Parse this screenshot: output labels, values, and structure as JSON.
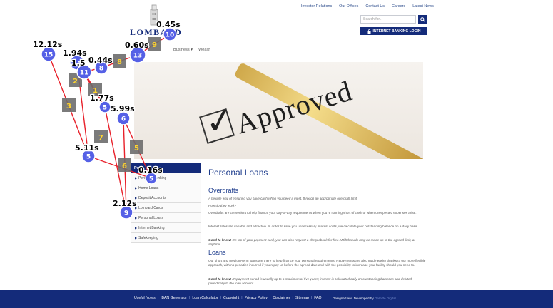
{
  "header": {
    "top_links": [
      "Investor Relations",
      "Our Offices",
      "Contact Us",
      "Careers",
      "Latest News"
    ],
    "search_placeholder": "Search for...",
    "search_icon": "search-icon",
    "login_icon": "lock-icon",
    "login_label": "INTERNET BANKING LOGIN",
    "logo_text": "LOMBARD",
    "nav": [
      "Business ▾",
      "Wealth"
    ]
  },
  "hero": {
    "word": "Approved"
  },
  "sidebar": {
    "title": "Pe",
    "items": [
      "Personal Banking",
      "Home Loans",
      "Deposit Accounts",
      "Lombard Cards",
      "Personal Loans",
      "Internet Banking",
      "Safekeeping"
    ]
  },
  "content": {
    "title": "Personal Loans",
    "overdrafts": {
      "heading": "Overdrafts",
      "lead": "A flexible way of ensuring you have cash when you need it most, through an appropriate overdraft limit.",
      "q": "How do they work?",
      "p1": "Overdrafts are convenient to help finance your day-to-day requirements when you're running short of cash or when unexpected expenses arise.",
      "p2": "Interest rates are variable and attractive. In order to save you unnecessary interest costs, we calculate your outstanding balance on a daily basis.",
      "good_label": "Good to know!",
      "good_text": " On top of your payment card, you can also request a chequebook for free. Withdrawals may be made up to the agreed limit, at anytime."
    },
    "loans": {
      "heading": "Loans",
      "p1": "Our short and medium-term loans are there to help finance your personal requirements. Repayments are also made easier thanks to our more flexible approach, with no penalties incurred if you repay us before the agreed date and with the possibility to increase your facility should you need to.",
      "good_label": "Good to know!",
      "good_text": " Repayment period is usually up to a maximum of five years; interest is calculated daily on outstanding balances and debited periodically to the loan account."
    }
  },
  "footer": {
    "links": [
      "Useful Notes",
      "IBAN Generator",
      "Loan Calculator",
      "Copyright",
      "Privacy Policy",
      "Disclaimer",
      "Sitemap",
      "FAQ"
    ],
    "credit_prefix": "Designed and Developed by ",
    "credit_name": "Deloitte Digital"
  },
  "overlay": {
    "colors": {
      "circle": "#5560e6",
      "line": "#e8202a",
      "square": "#6d6d6d",
      "number": "#ffd52e"
    },
    "circles": [
      {
        "n": "15",
        "t": "12.12s"
      },
      {
        "n": "14",
        "t": "1.94s"
      },
      {
        "n": "11",
        "t": "1.5"
      },
      {
        "n": "8",
        "t": "0.44s"
      },
      {
        "n": "13",
        "t": "0.60s"
      },
      {
        "n": "10",
        "t": "0.45s"
      },
      {
        "n": "5",
        "t": "1.77s"
      },
      {
        "n": "6",
        "t": "5.99s"
      },
      {
        "n": "5",
        "t": "5.11s"
      },
      {
        "n": "5",
        "t": "0.16s"
      },
      {
        "n": "9",
        "t": "2.12s"
      }
    ],
    "squares": [
      "9",
      "8",
      "2",
      "1",
      "3",
      "7",
      "5",
      "6"
    ]
  }
}
